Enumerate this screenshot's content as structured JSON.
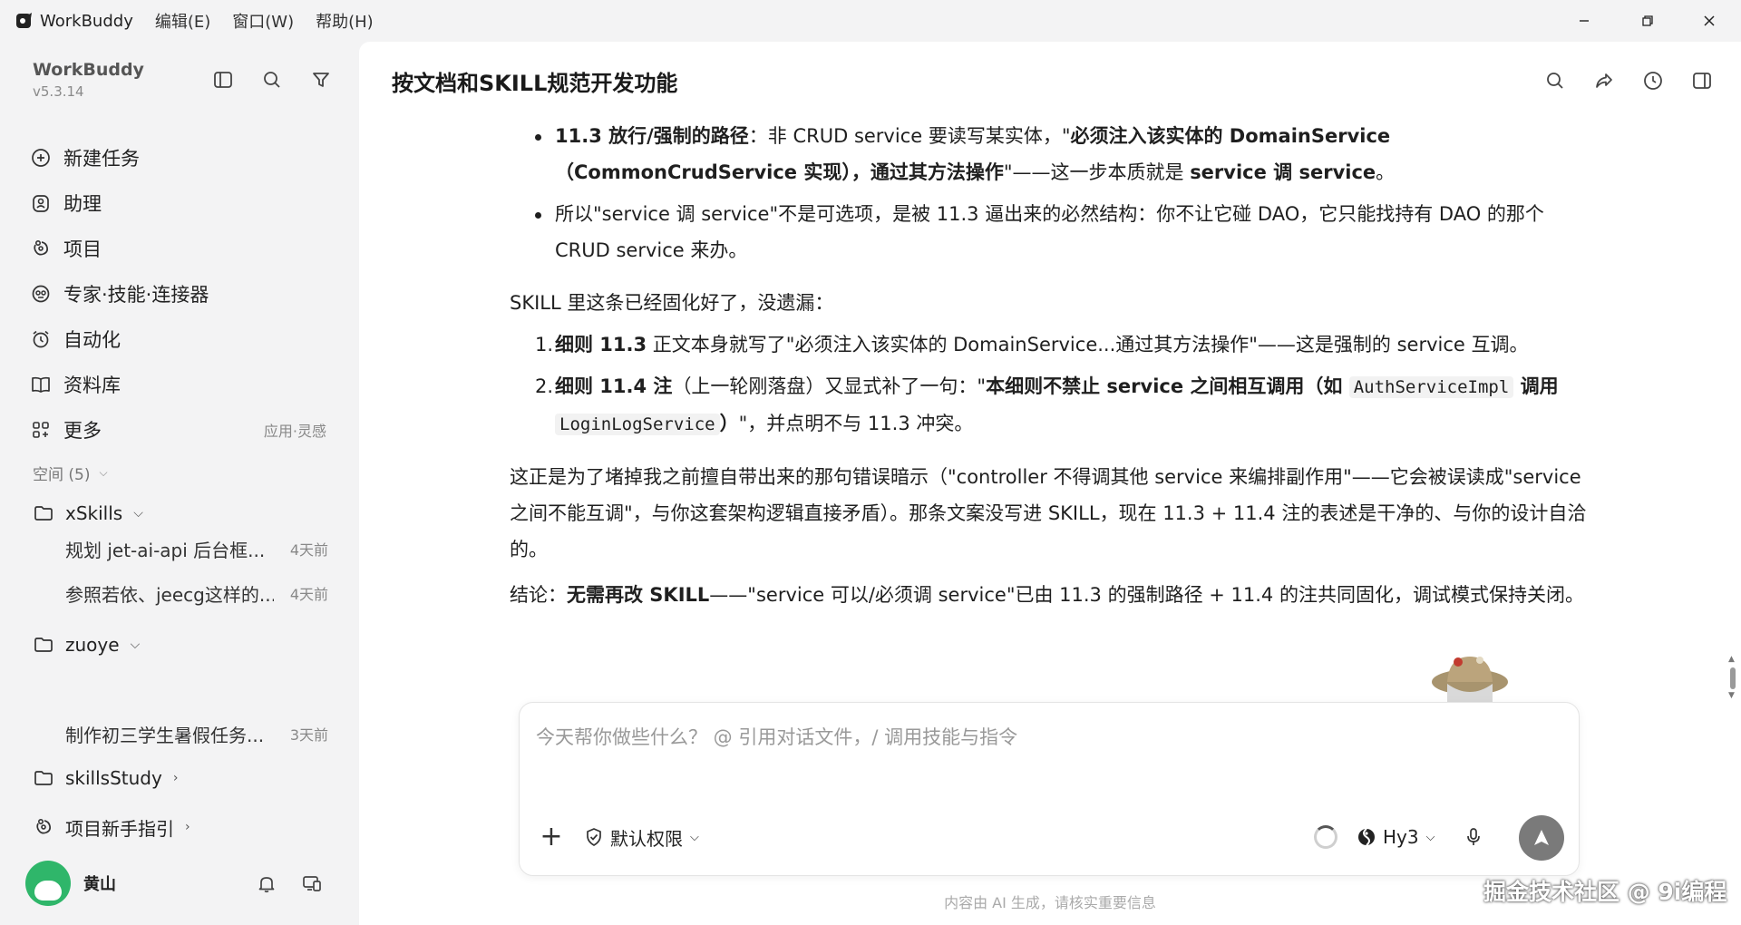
{
  "titlebar": {
    "app_name": "WorkBuddy",
    "menus": [
      "编辑(E)",
      "窗口(W)",
      "帮助(H)"
    ]
  },
  "sidebar": {
    "brand": "WorkBuddy",
    "version": "v5.3.14",
    "nav": [
      {
        "label": "新建任务",
        "icon": "plus-circle-icon"
      },
      {
        "label": "助理",
        "icon": "assistant-icon"
      },
      {
        "label": "项目",
        "icon": "project-icon"
      },
      {
        "label": "专家·技能·连接器",
        "icon": "expert-icon"
      },
      {
        "label": "自动化",
        "icon": "alarm-icon"
      },
      {
        "label": "资料库",
        "icon": "book-icon"
      },
      {
        "label": "更多",
        "icon": "grid-icon",
        "note": "应用·灵感"
      }
    ],
    "space_header": "空间 (5)",
    "folders": [
      {
        "name": "xSkills",
        "tasks": [
          {
            "title": "规划 jet-ai-api 后台框...",
            "time": "4天前"
          },
          {
            "title": "参照若依、jeecg这样的...",
            "time": "4天前"
          }
        ]
      },
      {
        "name": "zuoye",
        "tasks": [
          {
            "title": "制作初三学生暑假任务...",
            "time": "3天前"
          }
        ]
      },
      {
        "name": "skillsStudy",
        "tasks": []
      }
    ],
    "guide": "项目新手指引",
    "user": {
      "name": "黄山"
    }
  },
  "main": {
    "title": "按文档和SKILL规范开发功能",
    "bullets": [
      {
        "parts": [
          {
            "b": true,
            "t": "11.3 放行/强制的路径"
          },
          {
            "b": false,
            "t": "：非 CRUD service 要读写某实体，\""
          },
          {
            "b": true,
            "t": "必须注入该实体的 DomainService（CommonCrudService 实现），通过其方法操作"
          },
          {
            "b": false,
            "t": "\"——这一步本质就是 "
          },
          {
            "b": true,
            "t": "service 调 service"
          },
          {
            "b": false,
            "t": "。"
          }
        ]
      },
      {
        "parts": [
          {
            "b": false,
            "t": "所以\"service 调 service\"不是可选项，是被 11.3 逼出来的必然结构：你不让它碰 DAO，它只能找持有 DAO 的那个 CRUD service 来办。"
          }
        ]
      }
    ],
    "skill_intro": "SKILL 里这条已经固化好了，没遗漏：",
    "ordered": [
      {
        "num": "1.",
        "parts": [
          {
            "b": true,
            "t": "细则 11.3"
          },
          {
            "b": false,
            "t": " 正文本身就写了\"必须注入该实体的 DomainService...通过其方法操作\"——这是强制的 service 互调。"
          }
        ]
      },
      {
        "num": "2.",
        "parts": [
          {
            "b": true,
            "t": "细则 11.4 注"
          },
          {
            "b": false,
            "t": "（上一轮刚落盘）又显式补了一句：\""
          },
          {
            "b": true,
            "t": "本细则不禁止 service 之间相互调用（如 "
          },
          {
            "c": true,
            "t": "AuthServiceImpl"
          },
          {
            "b": true,
            "t": " 调用 "
          },
          {
            "c": true,
            "t": "LoginLogService"
          },
          {
            "b": true,
            "t": "）"
          },
          {
            "b": false,
            "t": "\"，并点明不与 11.3 冲突。"
          }
        ]
      }
    ],
    "para_fix": "这正是为了堵掉我之前擅自带出来的那句错误暗示（\"controller 不得调其他 service 来编排副作用\"——它会被误读成\"service 之间不能互调\"，与你这套架构逻辑直接矛盾）。那条文案没写进 SKILL，现在 11.3 + 11.4 注的表述是干净的、与你的设计自洽的。",
    "conclusion": [
      {
        "b": false,
        "t": "结论："
      },
      {
        "b": true,
        "t": "无需再改 SKILL"
      },
      {
        "b": false,
        "t": "——\"service 可以/必须调 service\"已由 11.3 的强制路径 + 11.4 的注共同固化，调试模式保持关闭。"
      }
    ]
  },
  "composer": {
    "placeholder": "今天帮你做些什么？ @ 引用对话文件，/ 调用技能与指令",
    "permission": "默认权限",
    "model": "Hy3"
  },
  "disclaimer": "内容由 AI 生成，请核实重要信息",
  "watermark": "掘金技术社区 @ 9i编程"
}
